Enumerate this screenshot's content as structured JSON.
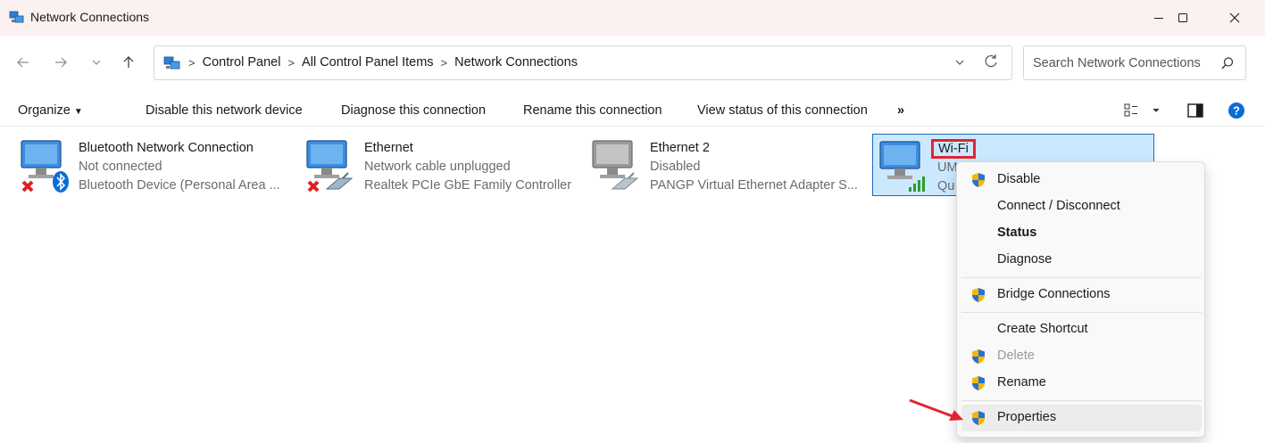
{
  "window": {
    "title": "Network Connections"
  },
  "address": {
    "crumbs": [
      "Control Panel",
      "All Control Panel Items",
      "Network Connections"
    ]
  },
  "search": {
    "placeholder": "Search Network Connections"
  },
  "toolbar": {
    "organize": "Organize",
    "disable": "Disable this network device",
    "diagnose": "Diagnose this connection",
    "rename": "Rename this connection",
    "view_status": "View status of this connection",
    "more": "»"
  },
  "connections": [
    {
      "name": "Bluetooth Network Connection",
      "status": "Not connected",
      "device": "Bluetooth Device (Personal Area ..."
    },
    {
      "name": "Ethernet",
      "status": "Network cable unplugged",
      "device": "Realtek PCIe GbE Family Controller"
    },
    {
      "name": "Ethernet 2",
      "status": "Disabled",
      "device": "PANGP Virtual Ethernet Adapter S..."
    },
    {
      "name": "Wi-Fi",
      "status": "UM",
      "device": "Qu"
    }
  ],
  "context_menu": {
    "items": [
      {
        "label": "Disable",
        "shield": true
      },
      {
        "label": "Connect / Disconnect",
        "shield": false
      },
      {
        "label": "Status",
        "shield": false,
        "bold": true
      },
      {
        "label": "Diagnose",
        "shield": false
      },
      {
        "label": "Bridge Connections",
        "shield": true
      },
      {
        "label": "Create Shortcut",
        "shield": false
      },
      {
        "label": "Delete",
        "shield": true,
        "disabled": true
      },
      {
        "label": "Rename",
        "shield": true
      },
      {
        "label": "Properties",
        "shield": true,
        "hover": true
      }
    ]
  },
  "colors": {
    "selection_bg": "#cce8ff",
    "selection_border": "#1a6bb8",
    "highlight_red": "#e1252f",
    "help_blue": "#0a6cd6",
    "titlebar_bg": "#fbf1f1"
  }
}
